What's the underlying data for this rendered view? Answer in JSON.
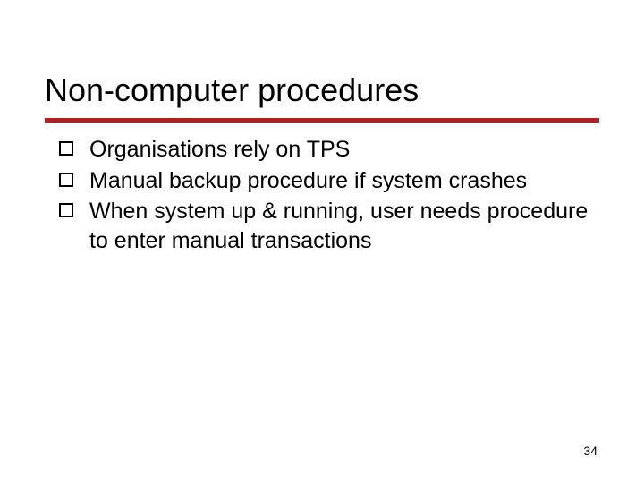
{
  "slide": {
    "title": "Non-computer procedures",
    "bullets": [
      "Organisations rely on TPS",
      "Manual backup procedure if system crashes",
      "When system up & running, user needs procedure to enter manual transactions"
    ],
    "page_number": "34"
  }
}
